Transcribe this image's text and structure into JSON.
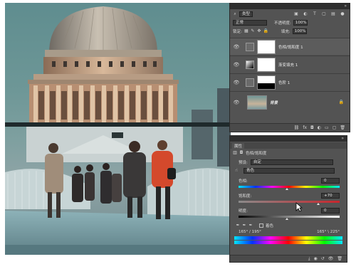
{
  "layers_panel": {
    "blend_mode_filter": "类型",
    "blend_mode": "正常",
    "opacity_label": "不透明度:",
    "opacity_value": "100%",
    "lock_label": "锁定:",
    "fill_label": "填充:",
    "fill_value": "100%",
    "layers": [
      {
        "name": "色相/饱和度 1",
        "selected": true
      },
      {
        "name": "渐变填充 1",
        "selected": false
      },
      {
        "name": "色阶 1",
        "selected": false
      },
      {
        "name": "背景",
        "selected": false
      }
    ]
  },
  "properties_panel": {
    "tab": "属性",
    "adjustment_title": "色相/饱和度",
    "preset_label": "预设:",
    "preset_value": "自定",
    "channel_value": "青色",
    "hue_label": "色相:",
    "hue_value": "0",
    "saturation_label": "饱和度:",
    "saturation_value": "+70",
    "lightness_label": "明度:",
    "lightness_value": "0",
    "colorize_label": "着色",
    "range_left": "165° / 195°",
    "range_right": "165° \\ 225°"
  },
  "accent_colors": {
    "panel_bg": "#535353",
    "titlebar": "#2e2e2e",
    "saturation_track": "#c8262d"
  }
}
